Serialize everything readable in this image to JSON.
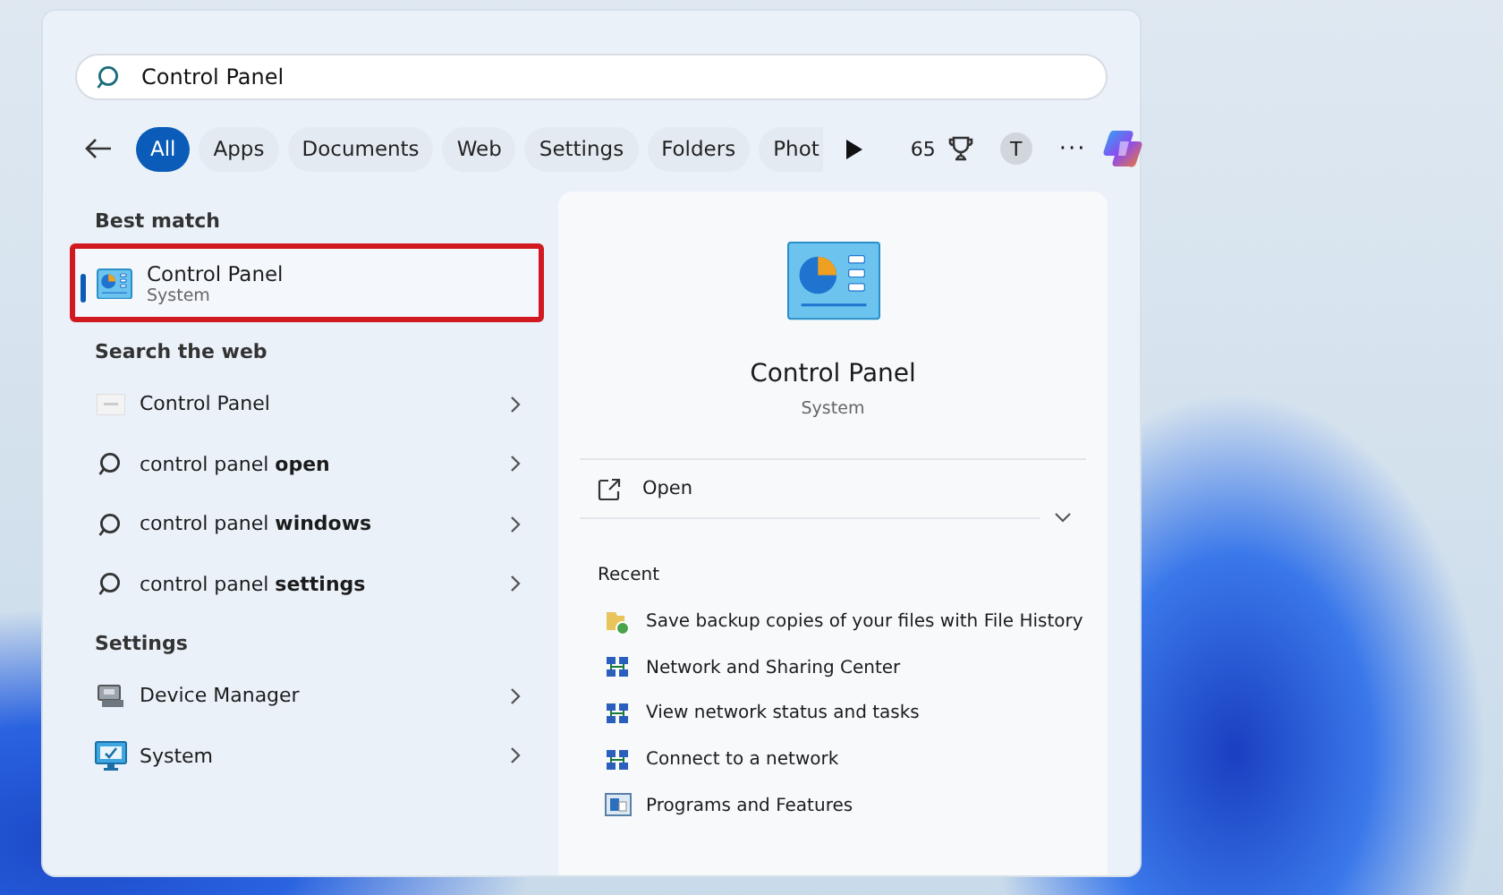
{
  "search": {
    "value": "Control Panel"
  },
  "filters": [
    {
      "label": "All",
      "selected": true
    },
    {
      "label": "Apps",
      "selected": false
    },
    {
      "label": "Documents",
      "selected": false
    },
    {
      "label": "Web",
      "selected": false
    },
    {
      "label": "Settings",
      "selected": false
    },
    {
      "label": "Folders",
      "selected": false
    },
    {
      "label": "Phot",
      "selected": false
    }
  ],
  "points": "65",
  "account_initial": "T",
  "more": "···",
  "best_match": {
    "heading": "Best match",
    "title": "Control Panel",
    "subtitle": "System",
    "selected": true,
    "highlighted": true
  },
  "web": {
    "heading": "Search the web",
    "items": [
      {
        "kind": "site",
        "text": "Control Panel"
      },
      {
        "kind": "search",
        "text": "control panel **open**"
      },
      {
        "kind": "search",
        "text": "control panel **windows**"
      },
      {
        "kind": "search",
        "text": "control panel **settings**"
      }
    ]
  },
  "settings": {
    "heading": "Settings",
    "items": [
      {
        "kind": "device",
        "text": "Device Manager"
      },
      {
        "kind": "system",
        "text": "System"
      }
    ]
  },
  "detail": {
    "title": "Control Panel",
    "subtitle": "System",
    "actions": [
      {
        "label": "Open"
      }
    ],
    "expanded": false,
    "recent_heading": "Recent",
    "recent": [
      {
        "kind": "history",
        "text": "Save backup copies of your files with File History"
      },
      {
        "kind": "network",
        "text": "Network and Sharing Center"
      },
      {
        "kind": "network",
        "text": "View network status and tasks"
      },
      {
        "kind": "network",
        "text": "Connect to a network"
      },
      {
        "kind": "programs",
        "text": "Programs and Features"
      }
    ]
  }
}
